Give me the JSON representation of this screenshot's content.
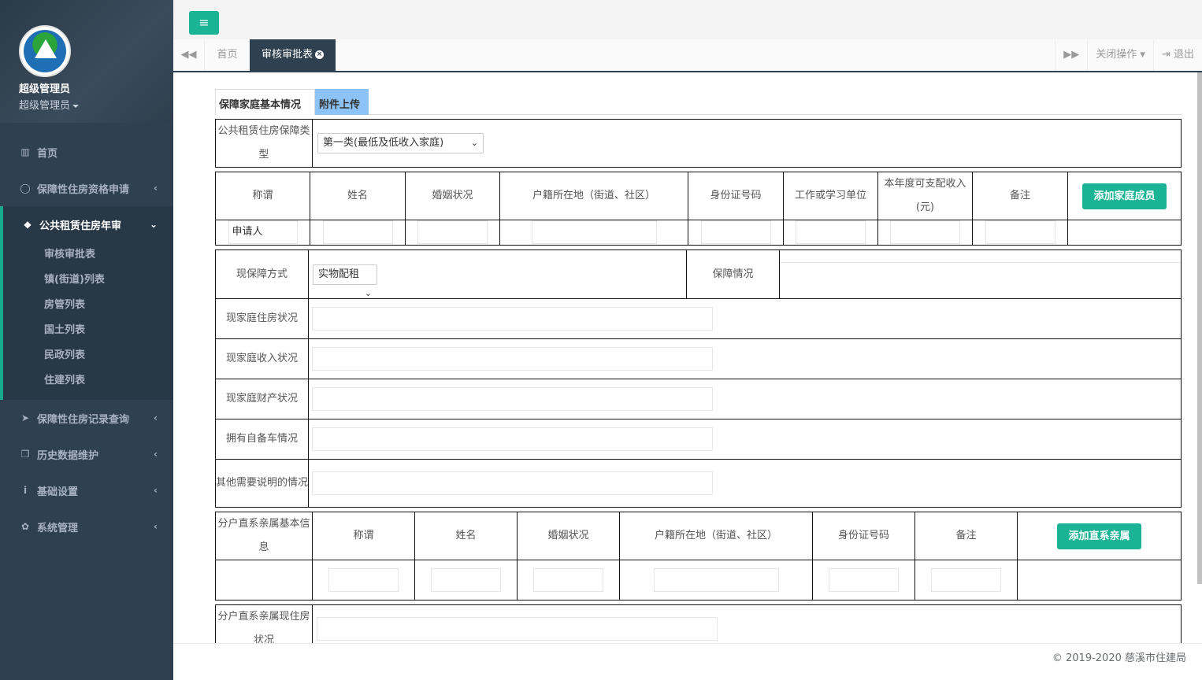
{
  "sidebar": {
    "user_name": "超级管理员",
    "user_role": "超级管理员",
    "nav": [
      {
        "label": "首页",
        "icon": "columns-icon"
      },
      {
        "label": "保障性住房资格申请",
        "icon": "comment-icon"
      },
      {
        "label": "公共租赁住房年审",
        "icon": "tag-icon"
      },
      {
        "label": "保障性住房记录查询",
        "icon": "paper-plane-icon"
      },
      {
        "label": "历史数据维护",
        "icon": "copy-icon"
      },
      {
        "label": "基础设置",
        "icon": "info-icon"
      },
      {
        "label": "系统管理",
        "icon": "gear-icon"
      }
    ],
    "submenu": [
      "审核审批表",
      "镇(街道)列表",
      "房管列表",
      "国土列表",
      "民政列表",
      "住建列表"
    ]
  },
  "tabs": {
    "home": "首页",
    "active": "审核审批表",
    "close_ops": "关闭操作",
    "logout": "退出"
  },
  "form": {
    "tab_basic": "保障家庭基本情况",
    "tab_attach": "附件上传",
    "type_label": "公共租赁住房保障类型",
    "type_value": "第一类(最低及低收入家庭)",
    "members_headers": [
      "称谓",
      "姓名",
      "婚姻状况",
      "户籍所在地（街道、社区）",
      "身份证号码",
      "工作或学习单位",
      "本年度可支配收入(元)",
      "备注"
    ],
    "add_member_button": "添加家庭成员",
    "applicant_value": "申请人",
    "current_mode_label": "现保障方式",
    "current_mode_value": "实物配租",
    "status_label": "保障情况",
    "housing_label": "现家庭住房状况",
    "income_label": "现家庭收入状况",
    "property_label": "现家庭财产状况",
    "car_label": "拥有自备车情况",
    "other_label": "其他需要说明的情况",
    "relatives_label": "分户直系亲属基本信息",
    "relatives_headers": [
      "称谓",
      "姓名",
      "婚姻状况",
      "户籍所在地（街道、社区）",
      "身份证号码",
      "备注"
    ],
    "add_relative_button": "添加直系亲属",
    "relatives_housing_label": "分户直系亲属现住房状况"
  },
  "footer": "© 2019-2020 慈溪市住建局",
  "colors": {
    "accent": "#1ab394",
    "sidebar": "#2f4050",
    "tab_active": "#2f4050",
    "attach_tab": "#8cc2f5"
  }
}
